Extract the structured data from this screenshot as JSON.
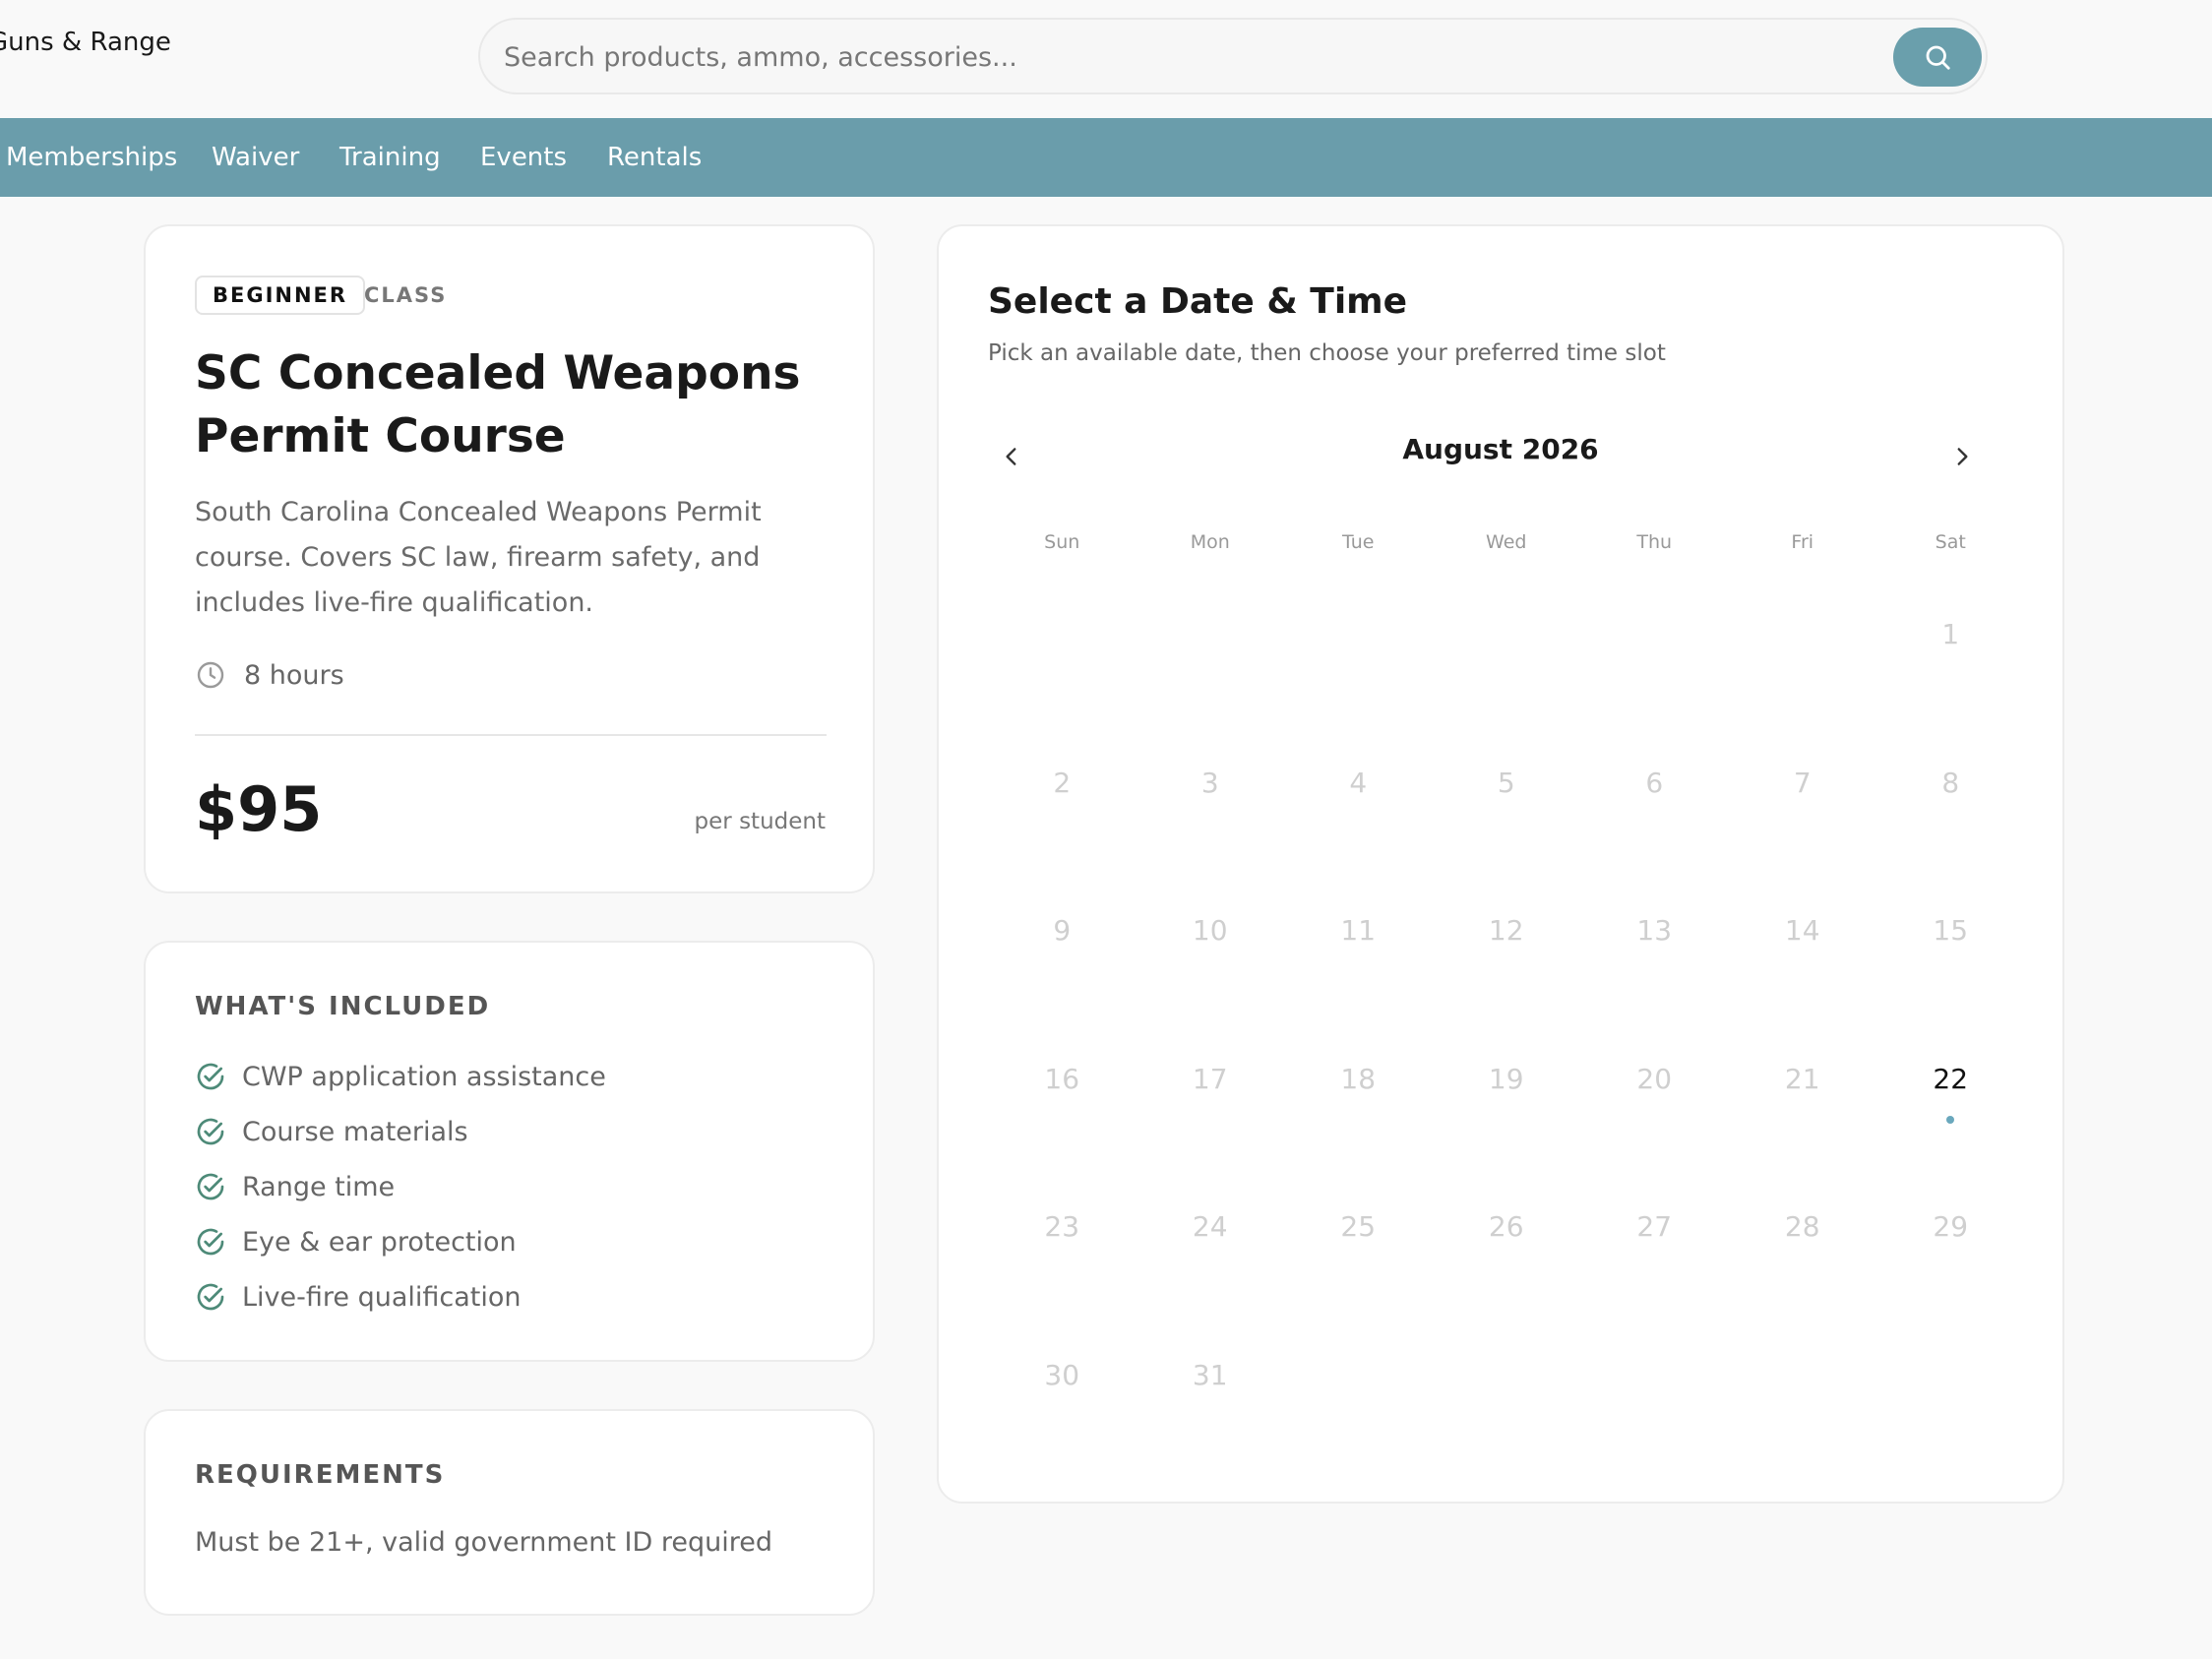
{
  "header": {
    "brand": "Guns & Range",
    "search_placeholder": "Search products, ammo, accessories..."
  },
  "nav": [
    "Memberships",
    "Waiver",
    "Training",
    "Events",
    "Rentals"
  ],
  "course": {
    "level_badge": "BEGINNER",
    "type_badge": "CLASS",
    "title": "SC Concealed Weapons Permit Course",
    "description": "South Carolina Concealed Weapons Permit course. Covers SC law, firearm safety, and includes live-fire qualification.",
    "duration": "8 hours",
    "price": "$95",
    "price_unit": "per student"
  },
  "included": {
    "heading": "WHAT'S INCLUDED",
    "items": [
      "CWP application assistance",
      "Course materials",
      "Range time",
      "Eye & ear protection",
      "Live-fire qualification"
    ]
  },
  "requirements": {
    "heading": "REQUIREMENTS",
    "text": "Must be 21+, valid government ID required"
  },
  "calendar": {
    "title": "Select a Date & Time",
    "subtitle": "Pick an available date, then choose your preferred time slot",
    "month_label": "August 2026",
    "weekdays": [
      "Sun",
      "Mon",
      "Tue",
      "Wed",
      "Thu",
      "Fri",
      "Sat"
    ],
    "leading_blank_days": 6,
    "days_in_month": 31,
    "available_days": [
      22
    ]
  },
  "colors": {
    "accent": "#6a9dab",
    "available_dot": "#6aa8bd",
    "check": "#4d8a78"
  }
}
